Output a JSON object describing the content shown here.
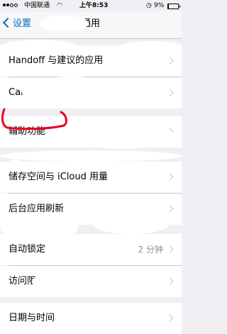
{
  "status": {
    "carrier": "中国联通",
    "wifi_icon": "wifi-icon",
    "time": "上午8:53",
    "battery_pct": "9%",
    "battery_level": 0.09
  },
  "nav": {
    "back_label": "设置",
    "title": "通用"
  },
  "rows": [
    {
      "label": "Handoff 与建议的应用",
      "value": "",
      "chevron": true
    },
    {
      "label": "CarPlay",
      "value": "",
      "chevron": true
    },
    {
      "label": "辅助功能",
      "value": "",
      "chevron": true
    },
    {
      "label": "储存空间与 iCloud 用量",
      "value": "",
      "chevron": true
    },
    {
      "label": "后台应用刷新",
      "value": "",
      "chevron": true
    },
    {
      "label": "自动锁定",
      "value": "2 分钟",
      "chevron": true
    },
    {
      "label": "访问限制",
      "value": "",
      "chevron": true
    },
    {
      "label": "日期与时间",
      "value": "",
      "chevron": true
    }
  ],
  "colors": {
    "accent": "#0070c9",
    "annotation": "#e8001c",
    "background": "#efeff4"
  }
}
